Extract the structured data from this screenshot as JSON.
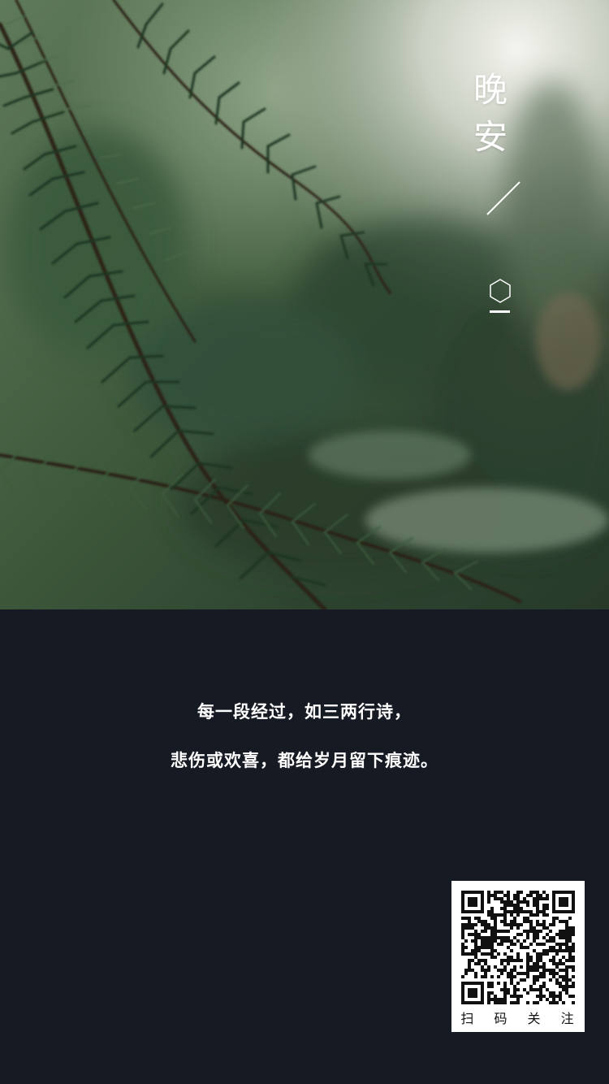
{
  "header": {
    "title_chars": [
      "晚",
      "安"
    ]
  },
  "poem": {
    "line1": "每一段经过，如三两行诗，",
    "line2": "悲伤或欢喜，都给岁月留下痕迹。"
  },
  "qr": {
    "caption": "扫 码 关 注"
  },
  "icons": {
    "divider": "slash-icon",
    "badge": "hexagon-icon"
  },
  "colors": {
    "background": "#161a22",
    "text": "#ffffff",
    "foliage": "#3f5a3c"
  }
}
